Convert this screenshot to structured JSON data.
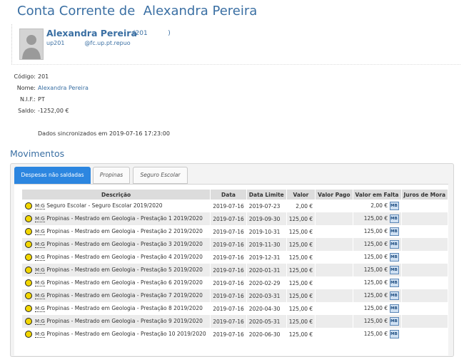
{
  "page_title": "Conta Corrente de  Alexandra Pereira",
  "profile": {
    "name": "Alexandra Pereira",
    "number": "(201          )",
    "username": "up201",
    "email": "@fc.up.pt.repuo"
  },
  "info": [
    {
      "label": "Código:",
      "value": "201"
    },
    {
      "label": "Nome:",
      "value": "Alexandra Pereira"
    },
    {
      "label": "N.I.F.:",
      "value": "PT"
    },
    {
      "label": "Saldo:",
      "value": "-1252,00 €"
    }
  ],
  "sync_text": "Dados sincronizados em 2019-07-16 17:23:00",
  "section_title": "Movimentos",
  "tabs": [
    {
      "label": "Despesas não saldadas"
    },
    {
      "label": "Propinas"
    },
    {
      "label": "Seguro Escolar"
    }
  ],
  "table": {
    "headers": [
      "Descrição",
      "Data",
      "Data Limite",
      "Valor",
      "Valor Pago",
      "Valor em Falta",
      "Juros de Mora"
    ],
    "mg_label": "M:G",
    "mb_label": "MB",
    "rows": [
      {
        "desc": "Seguro Escolar - Seguro Escolar 2019/2020",
        "date": "2019-07-16",
        "limit": "2019-07-23",
        "value": "2,00 €",
        "paid": "",
        "due": "2,00 €"
      },
      {
        "desc": "Propinas - Mestrado em Geologia - Prestação 1 2019/2020",
        "date": "2019-07-16",
        "limit": "2019-09-30",
        "value": "125,00 €",
        "paid": "",
        "due": "125,00 €"
      },
      {
        "desc": "Propinas - Mestrado em Geologia - Prestação 2 2019/2020",
        "date": "2019-07-16",
        "limit": "2019-10-31",
        "value": "125,00 €",
        "paid": "",
        "due": "125,00 €"
      },
      {
        "desc": "Propinas - Mestrado em Geologia - Prestação 3 2019/2020",
        "date": "2019-07-16",
        "limit": "2019-11-30",
        "value": "125,00 €",
        "paid": "",
        "due": "125,00 €"
      },
      {
        "desc": "Propinas - Mestrado em Geologia - Prestação 4 2019/2020",
        "date": "2019-07-16",
        "limit": "2019-12-31",
        "value": "125,00 €",
        "paid": "",
        "due": "125,00 €"
      },
      {
        "desc": "Propinas - Mestrado em Geologia - Prestação 5 2019/2020",
        "date": "2019-07-16",
        "limit": "2020-01-31",
        "value": "125,00 €",
        "paid": "",
        "due": "125,00 €"
      },
      {
        "desc": "Propinas - Mestrado em Geologia - Prestação 6 2019/2020",
        "date": "2019-07-16",
        "limit": "2020-02-29",
        "value": "125,00 €",
        "paid": "",
        "due": "125,00 €"
      },
      {
        "desc": "Propinas - Mestrado em Geologia - Prestação 7 2019/2020",
        "date": "2019-07-16",
        "limit": "2020-03-31",
        "value": "125,00 €",
        "paid": "",
        "due": "125,00 €"
      },
      {
        "desc": "Propinas - Mestrado em Geologia - Prestação 8 2019/2020",
        "date": "2019-07-16",
        "limit": "2020-04-30",
        "value": "125,00 €",
        "paid": "",
        "due": "125,00 €"
      },
      {
        "desc": "Propinas - Mestrado em Geologia - Prestação 9 2019/2020",
        "date": "2019-07-16",
        "limit": "2020-05-31",
        "value": "125,00 €",
        "paid": "",
        "due": "125,00 €"
      },
      {
        "desc": "Propinas - Mestrado em Geologia - Prestação 10 2019/2020",
        "date": "2019-07-16",
        "limit": "2020-06-30",
        "value": "125,00 €",
        "paid": "",
        "due": "125,00 €"
      }
    ]
  },
  "colors": {
    "accent": "#3a6fa3",
    "active_tab": "#2c86e0",
    "status_dot": "#f2d600"
  }
}
